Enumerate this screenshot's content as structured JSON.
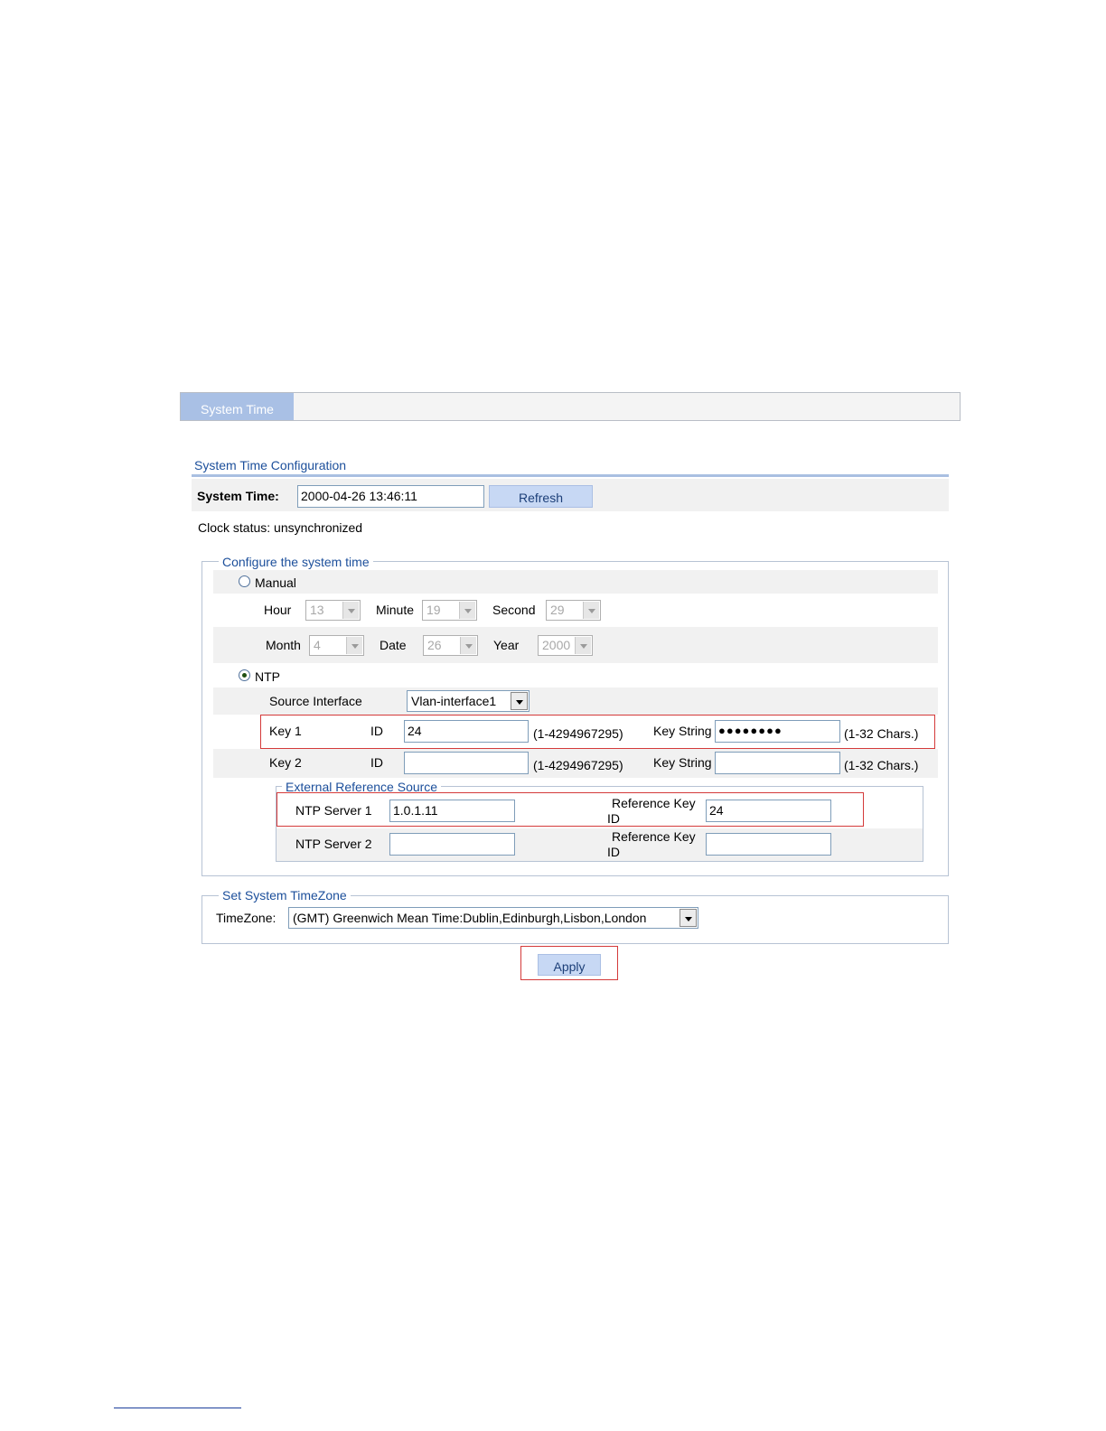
{
  "tab": {
    "label": "System Time"
  },
  "section": {
    "title": "System Time Configuration"
  },
  "system_time": {
    "label": "System Time:",
    "value": "2000-04-26  13:46:11",
    "refresh_label": "Refresh"
  },
  "clock_status": "Clock status: unsynchronized",
  "configure": {
    "legend": "Configure the system time",
    "manual": {
      "label": "Manual",
      "selected": false,
      "hour": {
        "label": "Hour",
        "value": "13"
      },
      "minute": {
        "label": "Minute",
        "value": "19"
      },
      "second": {
        "label": "Second",
        "value": "29"
      },
      "month": {
        "label": "Month",
        "value": "4"
      },
      "date": {
        "label": "Date",
        "value": "26"
      },
      "year": {
        "label": "Year",
        "value": "2000"
      }
    },
    "ntp": {
      "label": "NTP",
      "selected": true,
      "source_interface": {
        "label": "Source Interface",
        "value": "Vlan-interface1"
      },
      "key1": {
        "label": "Key 1",
        "id_label": "ID",
        "id_value": "24",
        "id_range": "(1-4294967295)",
        "key_string_label": "Key String",
        "key_string_value": "●●●●●●●●",
        "chars_hint": "(1-32 Chars.)"
      },
      "key2": {
        "label": "Key 2",
        "id_label": "ID",
        "id_value": "",
        "id_range": "(1-4294967295)",
        "key_string_label": "Key String",
        "key_string_value": "",
        "chars_hint": "(1-32 Chars.)"
      },
      "external": {
        "legend": "External Reference Source",
        "server1": {
          "label": "NTP Server 1",
          "value": "1.0.1.11",
          "ref_label_1": "Reference Key",
          "ref_label_2": "ID",
          "ref_value": "24"
        },
        "server2": {
          "label": "NTP Server 2",
          "value": "",
          "ref_label_1": "Reference Key",
          "ref_label_2": "ID",
          "ref_value": ""
        }
      }
    }
  },
  "timezone": {
    "legend": "Set System TimeZone",
    "label": "TimeZone:",
    "value": "(GMT) Greenwich Mean Time:Dublin,Edinburgh,Lisbon,London"
  },
  "apply_label": "Apply",
  "colors": {
    "accent": "#1c4f9b",
    "tab": "#a9c0e5",
    "button": "#c7d8f4",
    "highlight": "#d43a3a"
  }
}
